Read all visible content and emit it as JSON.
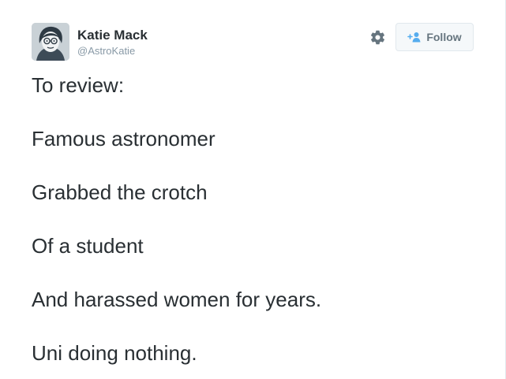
{
  "user": {
    "display_name": "Katie Mack",
    "handle": "@AstroKatie"
  },
  "actions": {
    "settings_icon": "gear-icon",
    "follow_label": "Follow",
    "follow_icon": "add-person-icon",
    "accent_color": "#55acee"
  },
  "tweet": {
    "lines": [
      "To review:",
      "Famous astronomer",
      "Grabbed the crotch",
      "Of a student",
      "And harassed women for years.",
      "Uni doing nothing."
    ]
  }
}
